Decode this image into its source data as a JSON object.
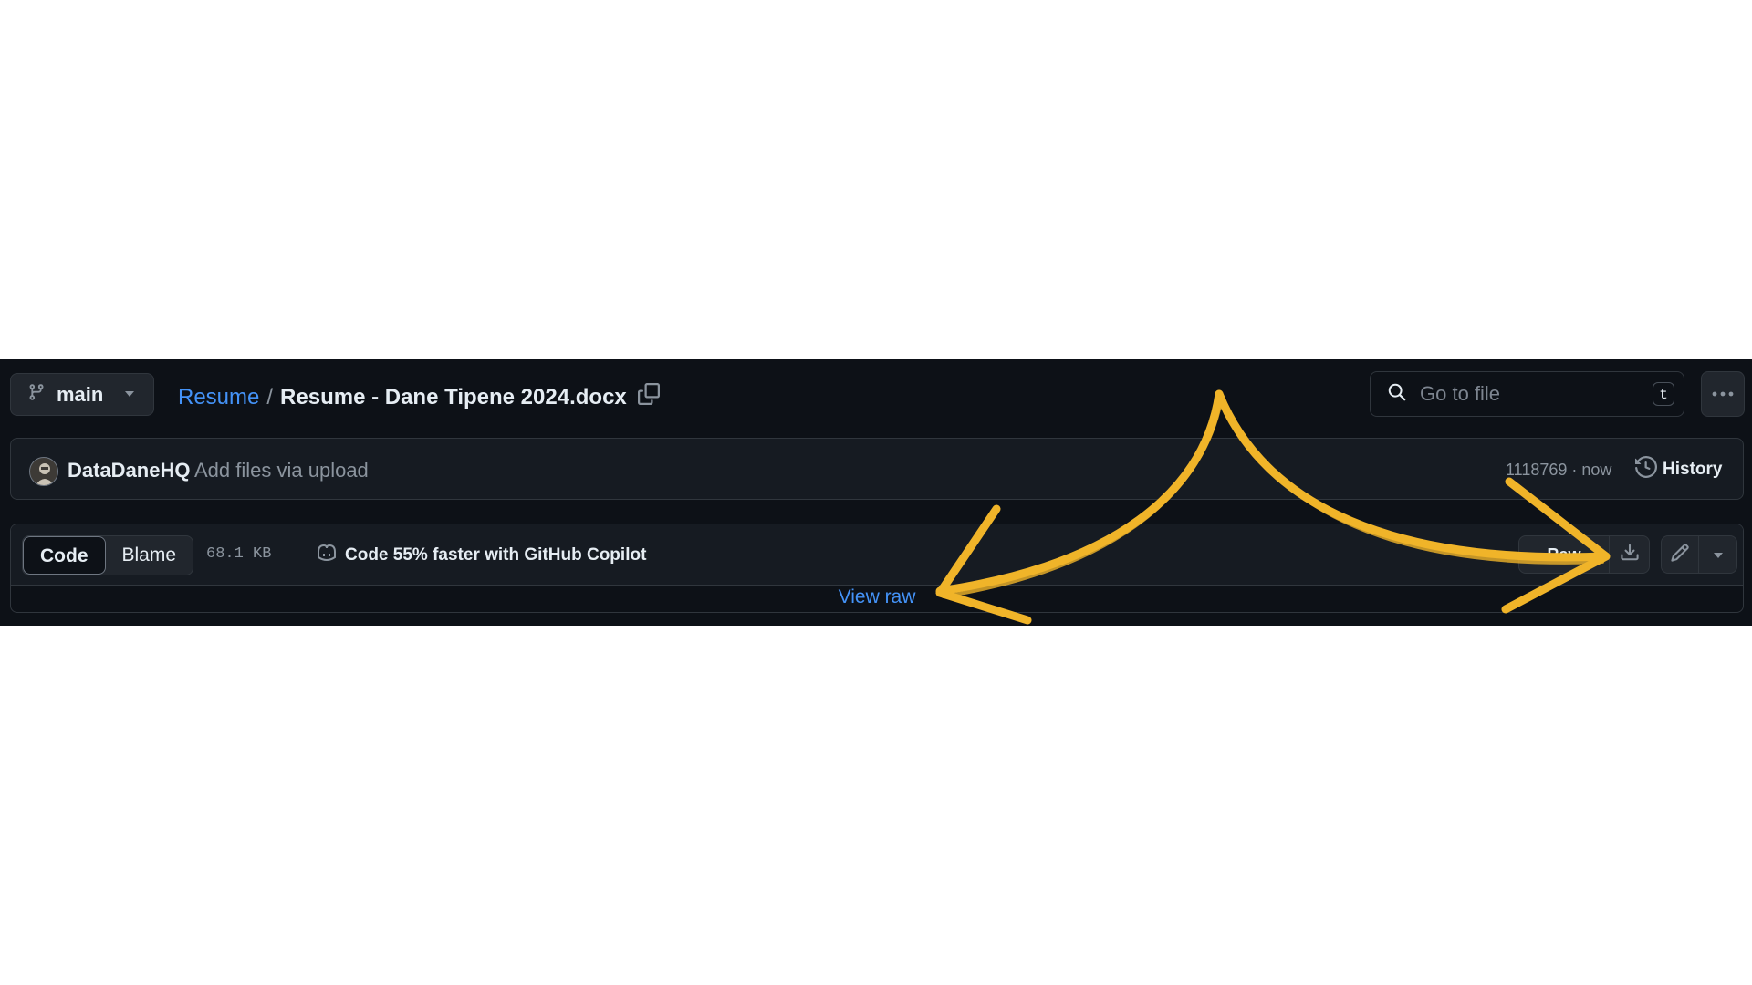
{
  "branch": {
    "name": "main",
    "icon": "git-branch-icon",
    "dropdown_icon": "triangle-down-icon"
  },
  "breadcrumb": {
    "repo": "Resume",
    "separator": "/",
    "file": "Resume - Dane Tipene 2024.docx",
    "copy_icon": "copy-icon"
  },
  "search": {
    "placeholder": "Go to file",
    "shortcut": "t",
    "icon": "search-icon"
  },
  "more": {
    "icon": "kebab-horizontal-icon"
  },
  "commit": {
    "author": "DataDaneHQ",
    "message": "Add files via upload",
    "sha_time": "1118769 · now",
    "history_label": "History",
    "history_icon": "history-icon"
  },
  "file_header": {
    "tabs": [
      {
        "label": "Code",
        "active": true
      },
      {
        "label": "Blame",
        "active": false
      }
    ],
    "size": "68.1 KB",
    "copilot_text": "Code 55% faster with GitHub Copilot",
    "copilot_icon": "copilot-icon",
    "raw_label": "Raw",
    "download_icon": "download-icon",
    "edit_icon": "pencil-icon",
    "edit_menu_icon": "triangle-down-icon"
  },
  "body": {
    "view_raw": "View raw"
  },
  "colors": {
    "background": "#0d1117",
    "panel": "#161b22",
    "border": "#30363d",
    "link": "#4493f8",
    "annotation": "#f0b429"
  }
}
